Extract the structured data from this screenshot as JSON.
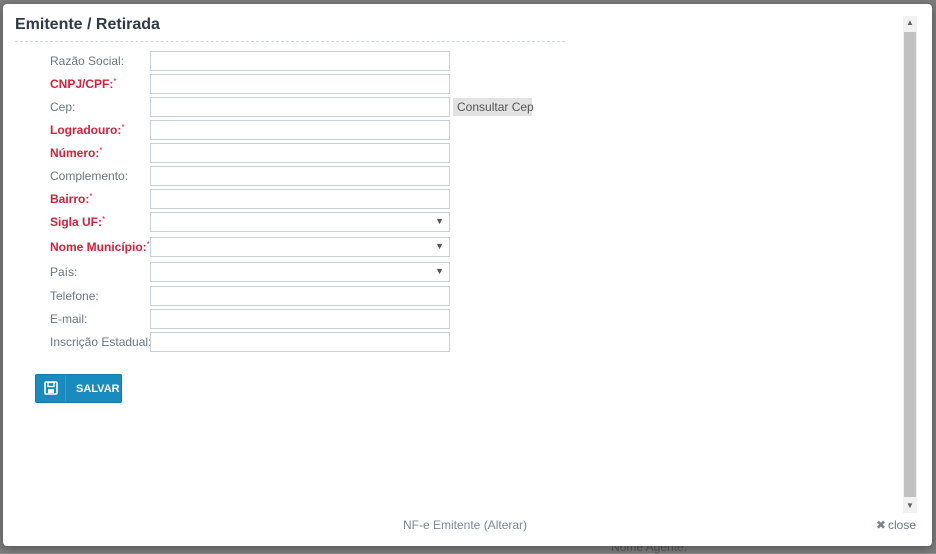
{
  "modal": {
    "title": "Emitente / Retirada",
    "footer_text": "NF-e Emitente (Alterar)",
    "close_label": "close",
    "save_label": "SALVAR",
    "consult_cep_label": "Consultar Cep"
  },
  "background": {
    "partial_text": "Nome Agente:"
  },
  "fields": {
    "razao_social": {
      "label": "Razão Social:",
      "value": ""
    },
    "cnpj_cpf": {
      "label": "CNPJ/CPF:",
      "value": ""
    },
    "cep": {
      "label": "Cep:",
      "value": ""
    },
    "logradouro": {
      "label": "Logradouro:",
      "value": ""
    },
    "numero": {
      "label": "Número:",
      "value": ""
    },
    "complemento": {
      "label": "Complemento:",
      "value": ""
    },
    "bairro": {
      "label": "Bairro:",
      "value": ""
    },
    "sigla_uf": {
      "label": "Sigla UF:",
      "value": ""
    },
    "nome_municipio": {
      "label": "Nome Município:",
      "value": ""
    },
    "pais": {
      "label": "País:",
      "value": ""
    },
    "telefone": {
      "label": "Telefone:",
      "value": ""
    },
    "email": {
      "label": "E-mail:",
      "value": ""
    },
    "inscricao_estadual": {
      "label": "Inscrição Estadual:",
      "value": ""
    }
  },
  "required_marker": "*",
  "colors": {
    "required_label": "#d3213a",
    "save_button": "#1a8bbf"
  },
  "icons": {
    "save": "floppy-disk-icon",
    "close": "x-icon",
    "select": "chevron-down-icon"
  }
}
